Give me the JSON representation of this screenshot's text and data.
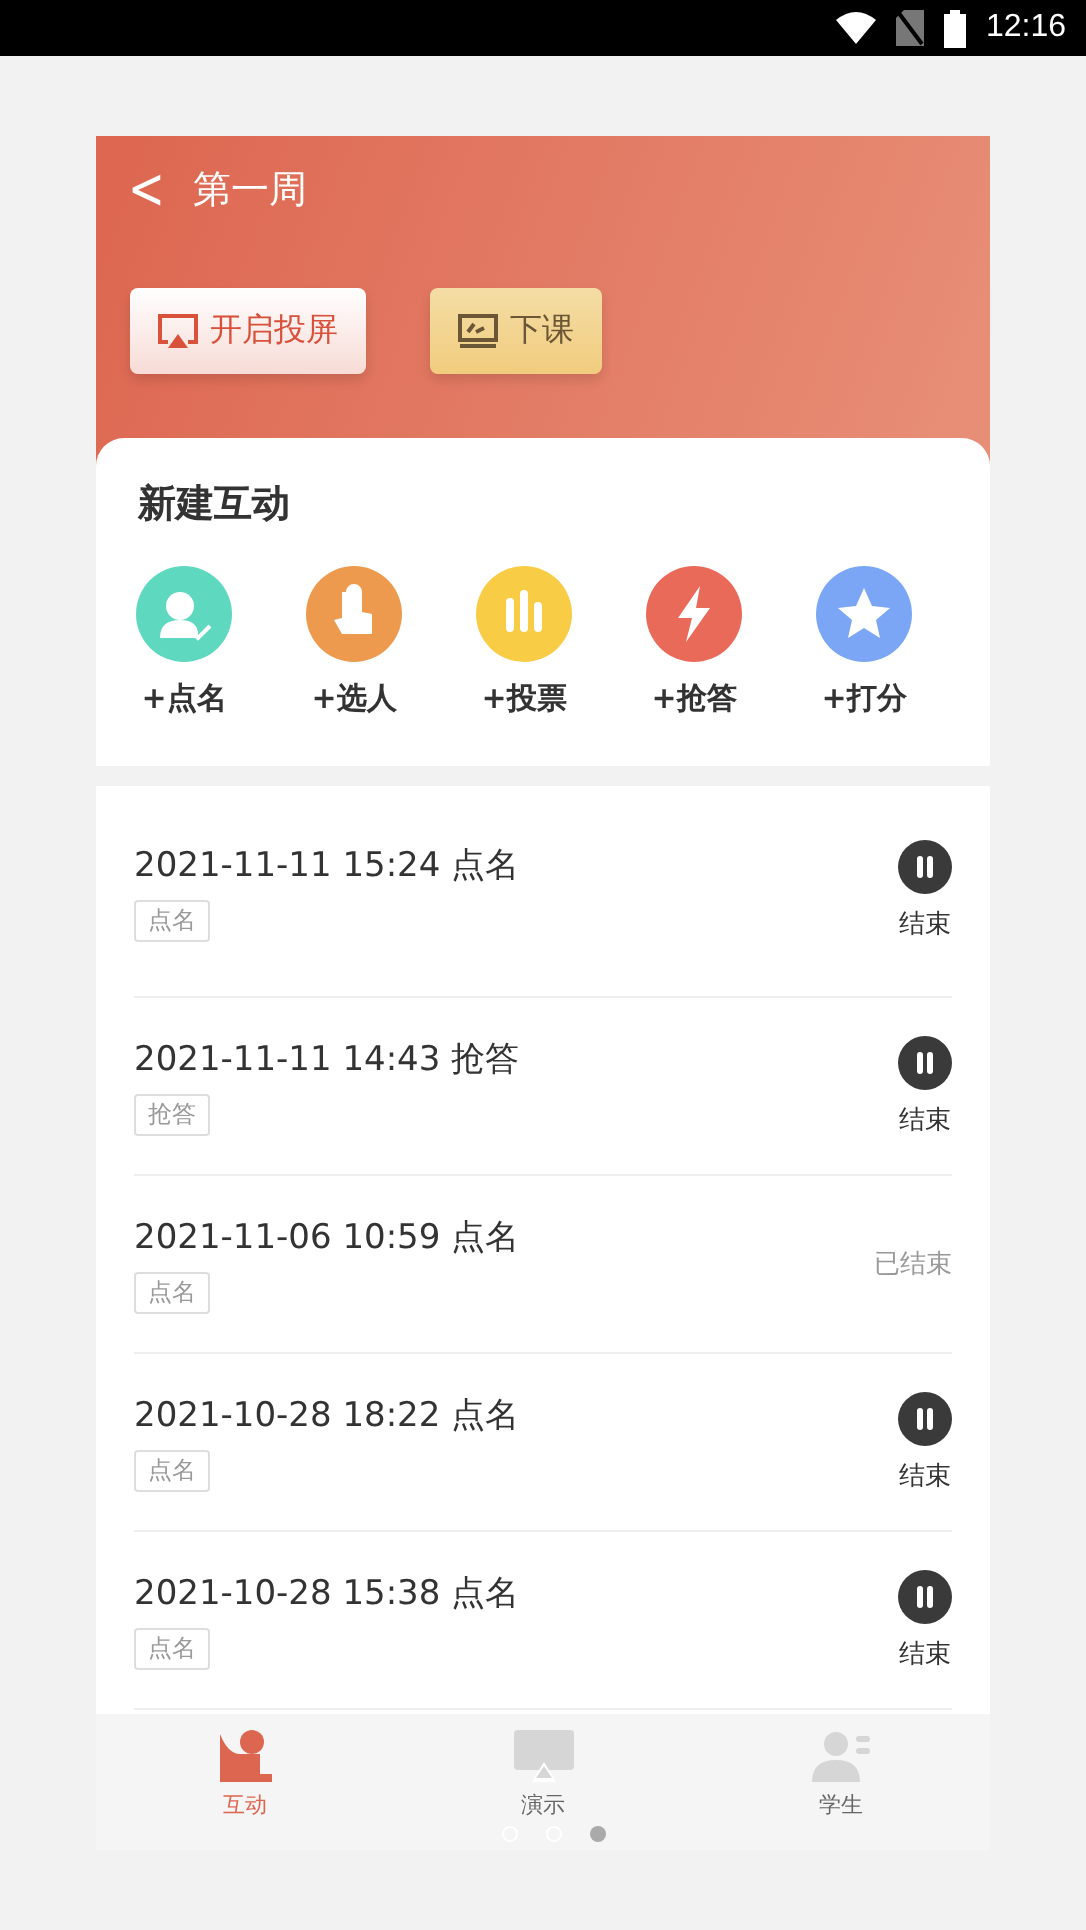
{
  "status_bar": {
    "time": "12:16"
  },
  "header": {
    "back": "<",
    "title": "第一周",
    "buttons": [
      {
        "label": "开启投屏",
        "kind": "cast"
      },
      {
        "label": "下课",
        "kind": "end"
      }
    ]
  },
  "new_interaction": {
    "title": "新建互动",
    "actions": [
      {
        "label": "+点名",
        "color": "#5fd8c0"
      },
      {
        "label": "+选人",
        "color": "#ee9a4e"
      },
      {
        "label": "+投票",
        "color": "#f8cc45"
      },
      {
        "label": "+抢答",
        "color": "#ea6a5a"
      },
      {
        "label": "+打分",
        "color": "#7aa6f5"
      }
    ]
  },
  "records": [
    {
      "title": "2021-11-11 15:24 点名",
      "tag": "点名",
      "kind": "running",
      "status": "结束"
    },
    {
      "title": "2021-11-11 14:43 抢答",
      "tag": "抢答",
      "kind": "running",
      "status": "结束"
    },
    {
      "title": "2021-11-06 10:59 点名",
      "tag": "点名",
      "kind": "ended",
      "status": "已结束"
    },
    {
      "title": "2021-10-28 18:22 点名",
      "tag": "点名",
      "kind": "running",
      "status": "结束"
    },
    {
      "title": "2021-10-28 15:38 点名",
      "tag": "点名",
      "kind": "running",
      "status": "结束"
    }
  ],
  "tab_bar": [
    {
      "label": "互动",
      "selected": true
    },
    {
      "label": "演示",
      "selected": false
    },
    {
      "label": "学生",
      "selected": false
    }
  ],
  "page_dots": [
    {
      "selected": false
    },
    {
      "selected": false
    },
    {
      "selected": true
    }
  ]
}
